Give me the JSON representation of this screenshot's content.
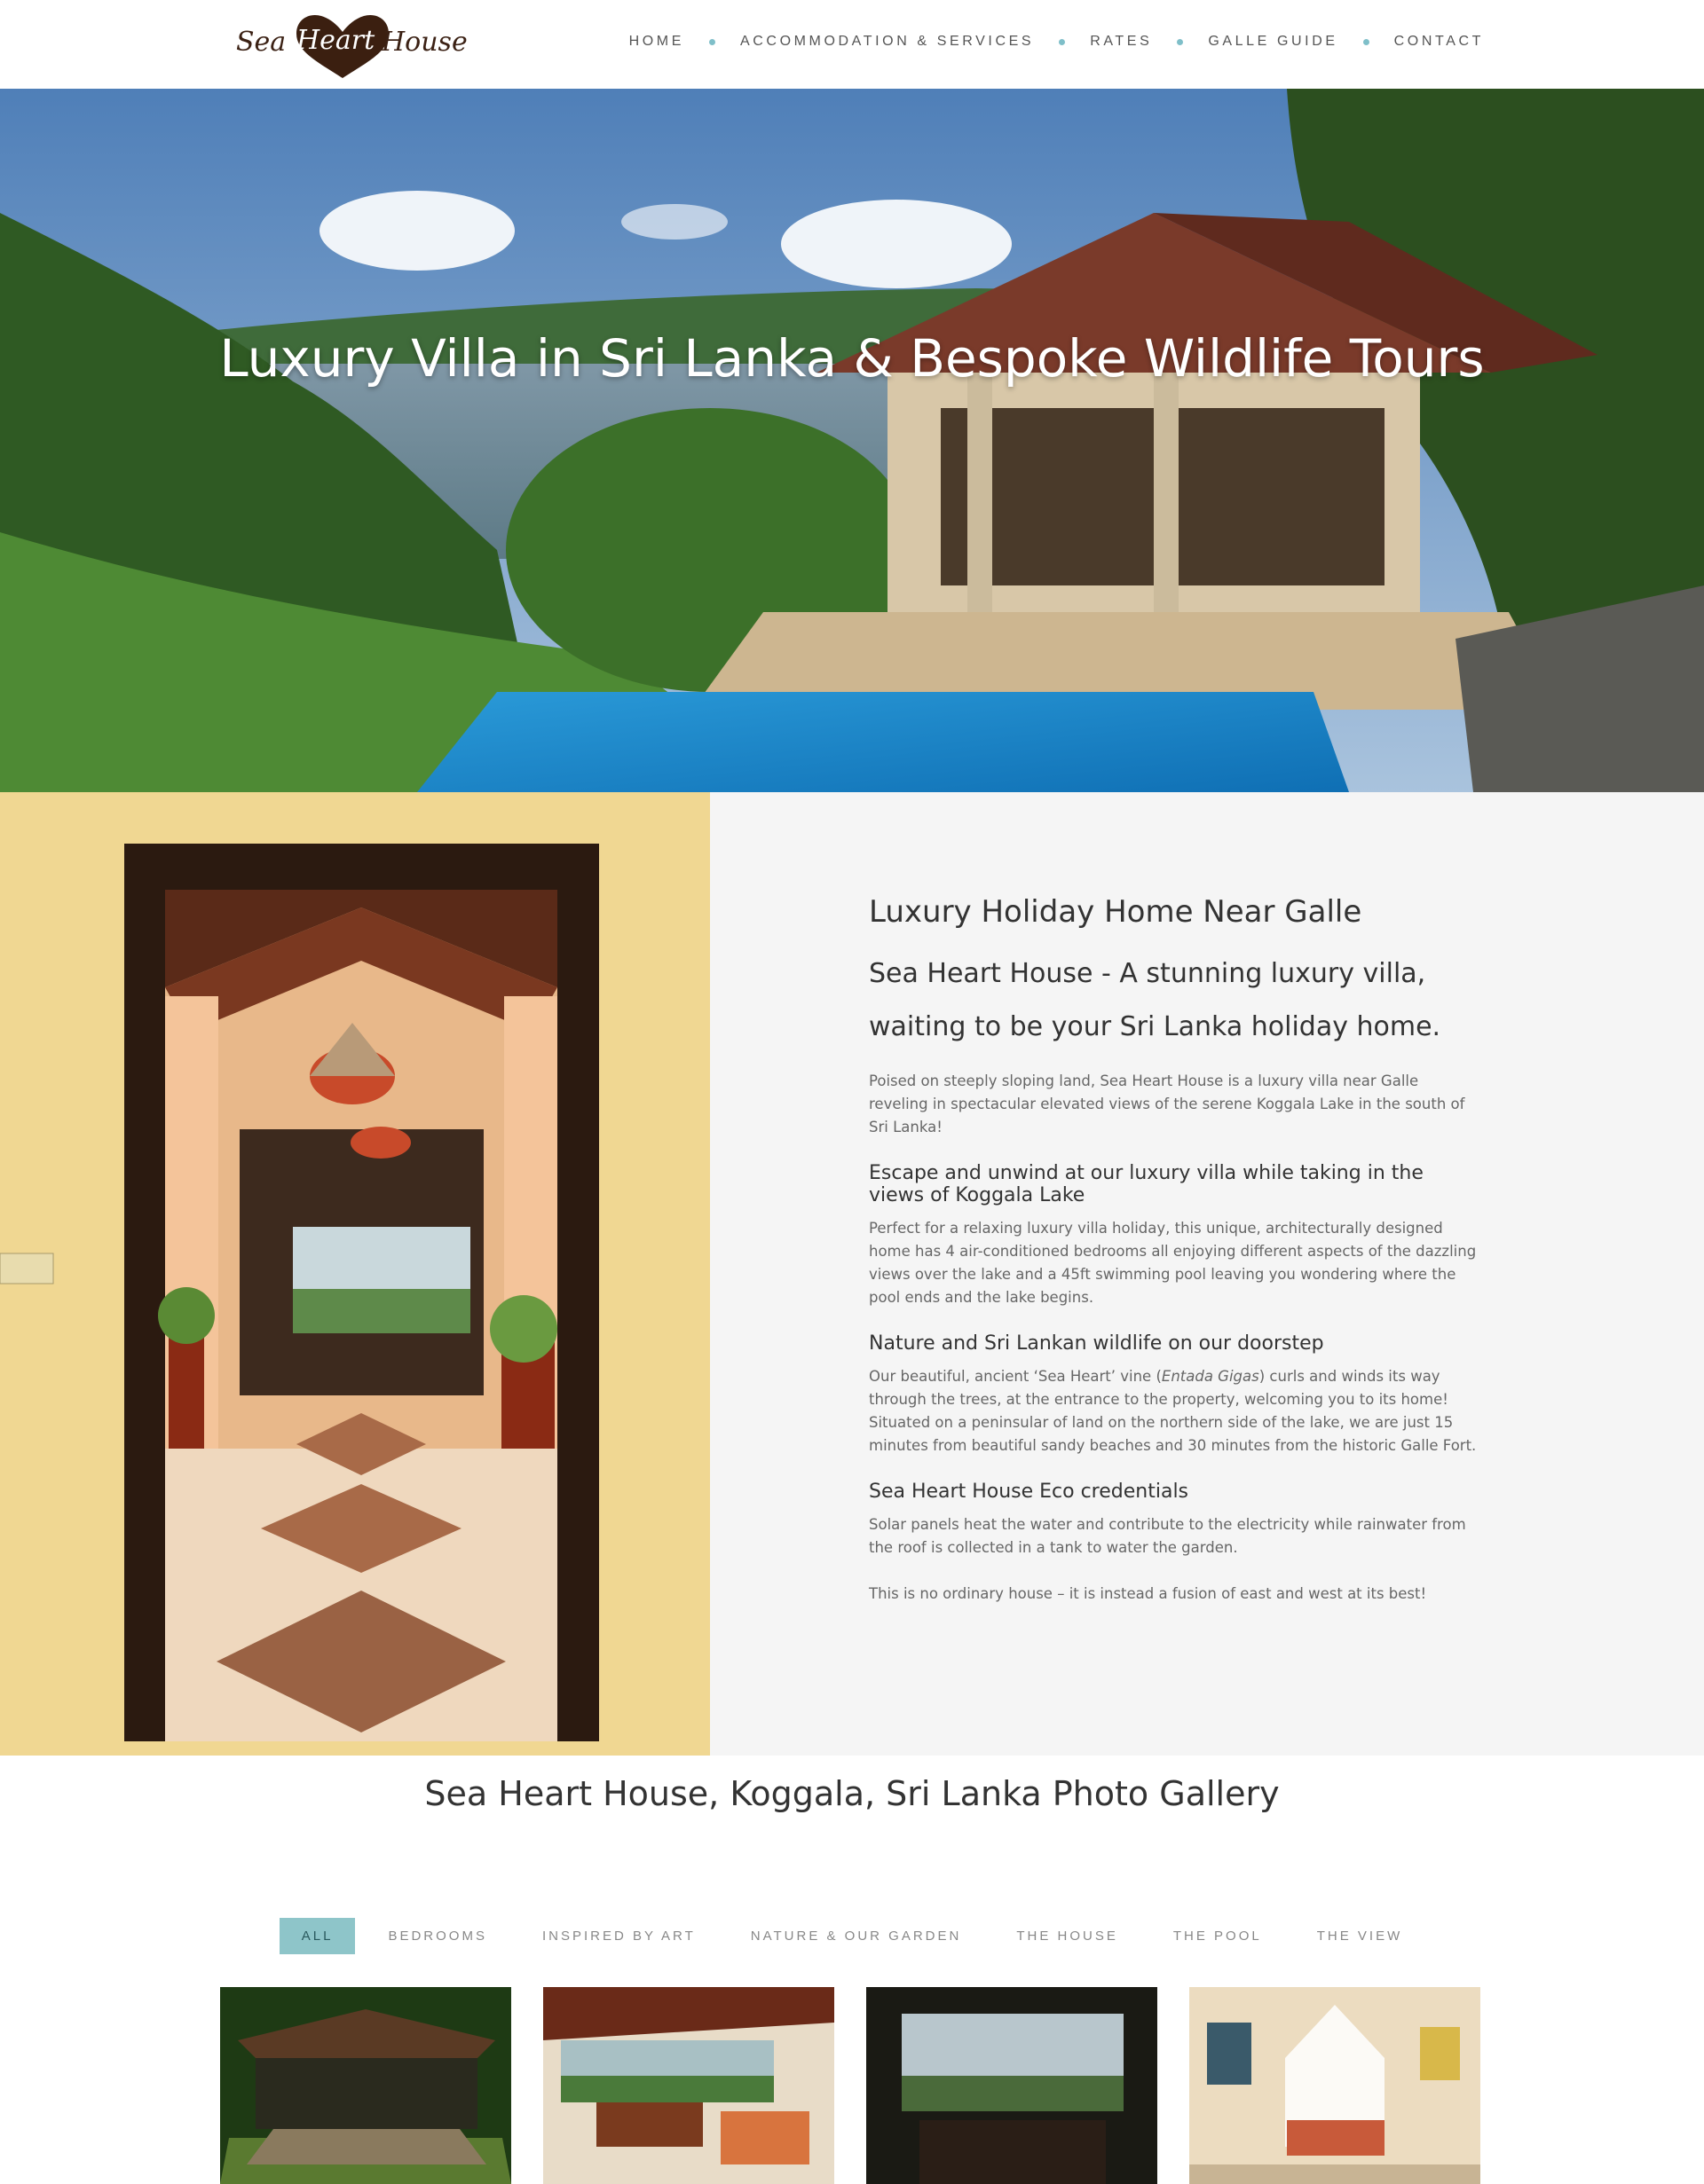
{
  "brand": {
    "logo_word1": "Sea",
    "logo_word2": "Heart",
    "logo_word3": "House",
    "logo_heart_color": "#3b1f10"
  },
  "nav": {
    "items": [
      {
        "label": "HOME"
      },
      {
        "label": "ACCOMMODATION & SERVICES"
      },
      {
        "label": "RATES"
      },
      {
        "label": "GALLE GUIDE"
      },
      {
        "label": "CONTACT"
      }
    ],
    "separator_color": "#7fbfc9"
  },
  "hero": {
    "title": "Luxury Villa in Sri Lanka & Bespoke Wildlife Tours"
  },
  "intro": {
    "heading": "Luxury Holiday Home Near Galle",
    "subheading": "Sea Heart House - A stunning luxury villa, waiting to be your Sri Lanka holiday home.",
    "paragraph1": "Poised on steeply sloping land, Sea Heart House is a luxury villa near Galle reveling in spectacular elevated views of the serene Koggala Lake in the south of Sri Lanka!",
    "section1_title": "Escape and unwind at our luxury villa while taking in the views of Koggala Lake",
    "section1_text": "Perfect for a relaxing luxury villa holiday, this unique, architecturally designed home has 4 air-conditioned bedrooms all enjoying different aspects of the dazzling views over the lake and a 45ft swimming pool leaving you wondering where the pool ends and the lake begins.",
    "section2_title": "Nature and Sri Lankan wildlife on our doorstep",
    "section2_text_before": "Our beautiful, ancient ‘Sea Heart’ vine (",
    "section2_text_italic": "Entada Gigas",
    "section2_text_after": ") curls and winds its way through the trees, at the entrance to the property, welcoming you to its home! Situated on a peninsular of land on the northern side of the lake, we are just 15 minutes from beautiful sandy beaches and 30 minutes from the historic Galle Fort.",
    "section3_title": "Sea Heart House Eco credentials",
    "section3_text": "Solar panels heat the water and contribute to the electricity while rainwater from the roof is collected in a tank to water the garden.",
    "closing": "This is no ordinary house – it is instead a fusion of east and west at its best!"
  },
  "gallery": {
    "title": "Sea Heart House, Koggala, Sri Lanka Photo Gallery",
    "filters": [
      {
        "label": "ALL",
        "active": true
      },
      {
        "label": "BEDROOMS"
      },
      {
        "label": "INSPIRED BY ART"
      },
      {
        "label": "NATURE & OUR GARDEN"
      },
      {
        "label": "THE HOUSE"
      },
      {
        "label": "THE POOL"
      },
      {
        "label": "THE VIEW"
      }
    ],
    "active_color": "#8ec5c9"
  }
}
